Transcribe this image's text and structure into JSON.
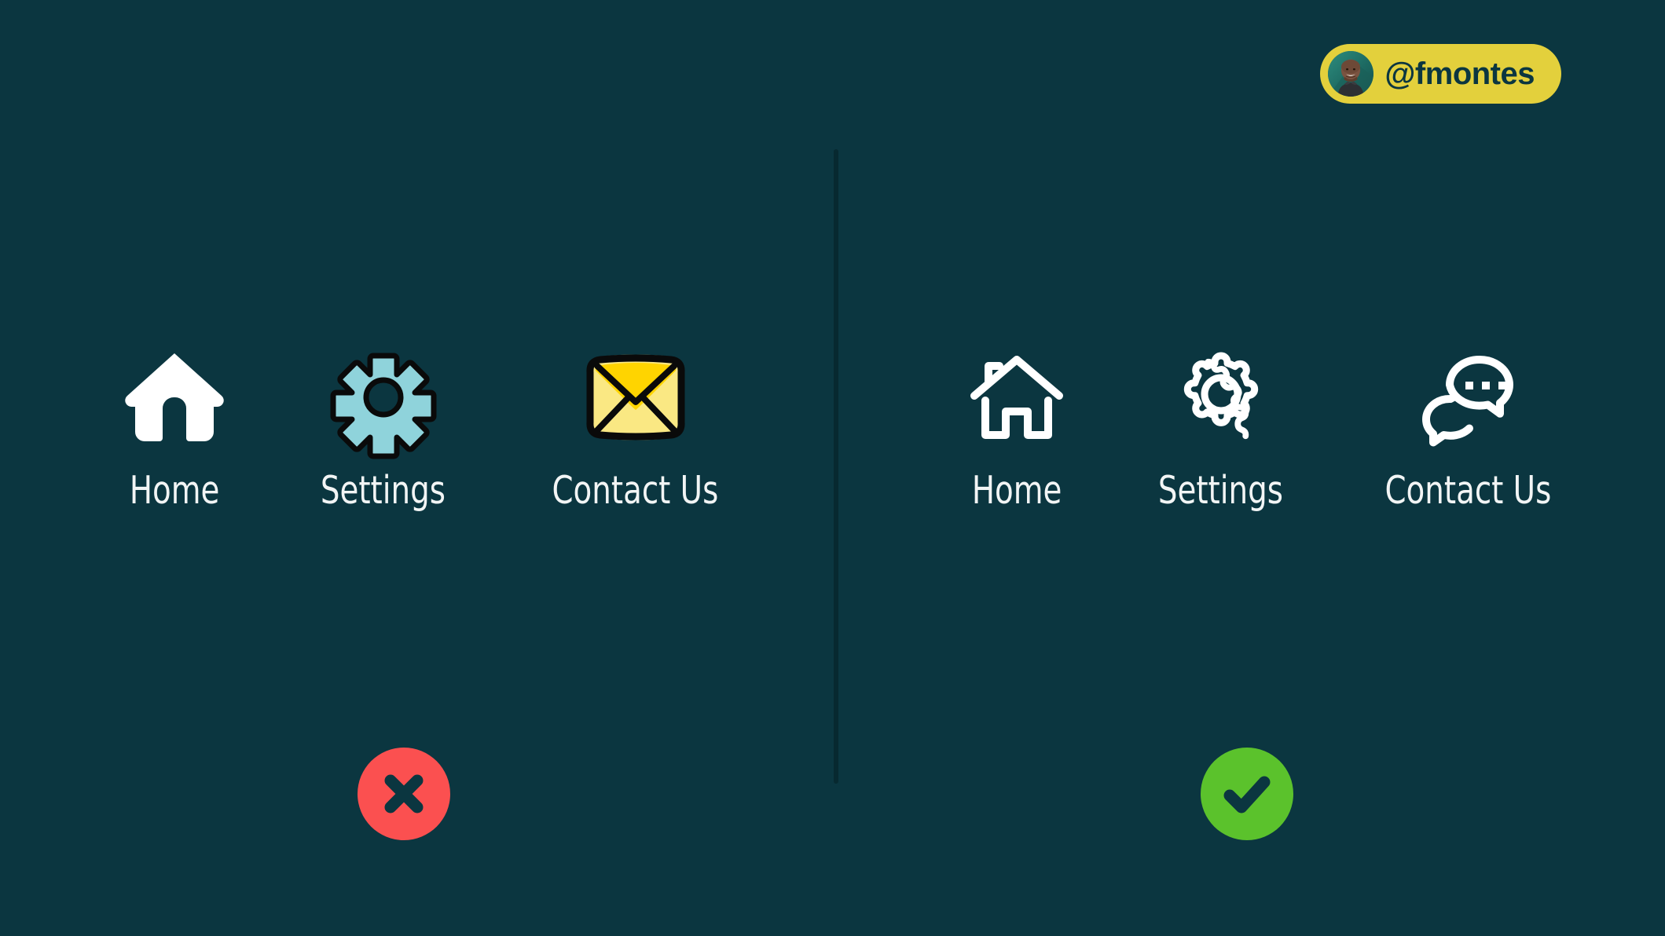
{
  "background_color": "#0b3640",
  "handle": {
    "text": "@fmontes",
    "pill_color": "#e3d03c",
    "text_color": "#0b3640",
    "avatar_name": "avatar"
  },
  "divider": {
    "color": "#072930"
  },
  "panels": [
    {
      "id": "left",
      "verdict": "incorrect",
      "verdict_icon": "cross-icon",
      "verdict_color": "#fb5050",
      "verdict_mark_color": "#0b3640",
      "items": [
        {
          "label": "Home",
          "icon": "home-filled-icon",
          "icon_style": "filled",
          "colors": {
            "fill": "#ffffff"
          }
        },
        {
          "label": "Settings",
          "icon": "gear-sticker-icon",
          "icon_style": "sticker",
          "colors": {
            "fill": "#8fd3db",
            "stroke": "#0a0a0a",
            "hole": "#0b3640"
          }
        },
        {
          "label": "Contact Us",
          "icon": "envelope-sticker-icon",
          "icon_style": "sticker",
          "colors": {
            "body": "#fae883",
            "flap": "#ffd400",
            "stroke": "#0a0a0a"
          }
        }
      ]
    },
    {
      "id": "right",
      "verdict": "correct",
      "verdict_icon": "check-icon",
      "verdict_color": "#5bc22c",
      "verdict_mark_color": "#0b3640",
      "items": [
        {
          "label": "Home",
          "icon": "home-outline-icon",
          "icon_style": "outline",
          "colors": {
            "stroke": "#ffffff"
          }
        },
        {
          "label": "Settings",
          "icon": "gear-outline-icon",
          "icon_style": "outline",
          "colors": {
            "stroke": "#ffffff"
          }
        },
        {
          "label": "Contact Us",
          "icon": "chat-bubbles-icon",
          "icon_style": "outline",
          "colors": {
            "stroke": "#ffffff"
          }
        }
      ]
    }
  ]
}
